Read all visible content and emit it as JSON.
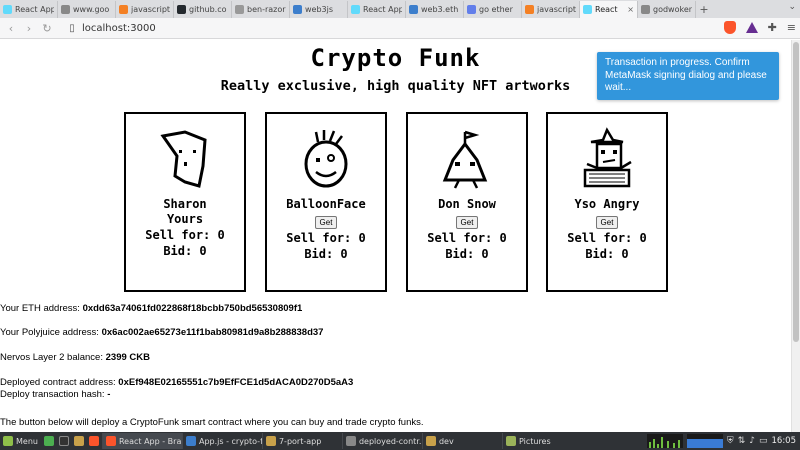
{
  "browser": {
    "tabs": [
      {
        "label": "React App",
        "color": "#61dafb"
      },
      {
        "label": "www.goo",
        "color": "#888888"
      },
      {
        "label": "javascript",
        "color": "#f48024"
      },
      {
        "label": "github.co",
        "color": "#24292e"
      },
      {
        "label": "ben-razor",
        "color": "#999999"
      },
      {
        "label": "web3js",
        "color": "#3c7ecc"
      },
      {
        "label": "React App",
        "color": "#61dafb"
      },
      {
        "label": "web3.eth",
        "color": "#3c7ecc"
      },
      {
        "label": "go ether",
        "color": "#627eea"
      },
      {
        "label": "javascript",
        "color": "#f48024"
      },
      {
        "label": "React",
        "color": "#61dafb",
        "active": true
      },
      {
        "label": "godwoken",
        "color": "#888888"
      }
    ],
    "url": "localhost:3000"
  },
  "page": {
    "title": "Crypto Funk",
    "subtitle": "Really exclusive, high quality NFT artworks",
    "toast": "Transaction in progress. Confirm MetaMask signing dialog and please wait...",
    "cards": [
      {
        "name_line1": "Sharon",
        "name_line2": "Yours",
        "sell": "Sell for: 0",
        "bid": "Bid: 0",
        "get": ""
      },
      {
        "name_line1": "BalloonFace",
        "name_line2": "",
        "sell": "Sell for: 0",
        "bid": "Bid: 0",
        "get": "Get"
      },
      {
        "name_line1": "Don Snow",
        "name_line2": "",
        "sell": "Sell for: 0",
        "bid": "Bid: 0",
        "get": "Get"
      },
      {
        "name_line1": "Yso Angry",
        "name_line2": "",
        "sell": "Sell for: 0",
        "bid": "Bid: 0",
        "get": "Get"
      }
    ],
    "info": {
      "eth_label": "Your ETH address: ",
      "eth_value": "0xdd63a74061fd022868f18bcbb750bd56530809f1",
      "poly_label": "Your Polyjuice address: ",
      "poly_value": "0x6ac002ae65273e11f1bab80981d9a8b288838d37",
      "balance_label": "Nervos Layer 2 balance: ",
      "balance_value": "2399 CKB",
      "contract_label": "Deployed contract address: ",
      "contract_value": "0xEf948E02165551c7b9EfFCE1d5dACA0D270D5aA3",
      "tx_label": "Deploy transaction hash: ",
      "tx_value": "-",
      "note": "The button below will deploy a CryptoFunk smart contract where you can buy and trade crypto funks."
    }
  },
  "taskbar": {
    "menu": "Menu",
    "tasks": [
      {
        "label": "React App - Bra...",
        "color": "#fb542b",
        "active": true
      },
      {
        "label": "App.js - crypto-f...",
        "color": "#3c7ecc"
      },
      {
        "label": "7-port-app",
        "color": "#c8a14a"
      },
      {
        "label": "deployed-contr...",
        "color": "#888888"
      },
      {
        "label": "dev",
        "color": "#c8a14a"
      },
      {
        "label": "Pictures",
        "color": "#9bb35a"
      }
    ],
    "clock": "16:05"
  }
}
